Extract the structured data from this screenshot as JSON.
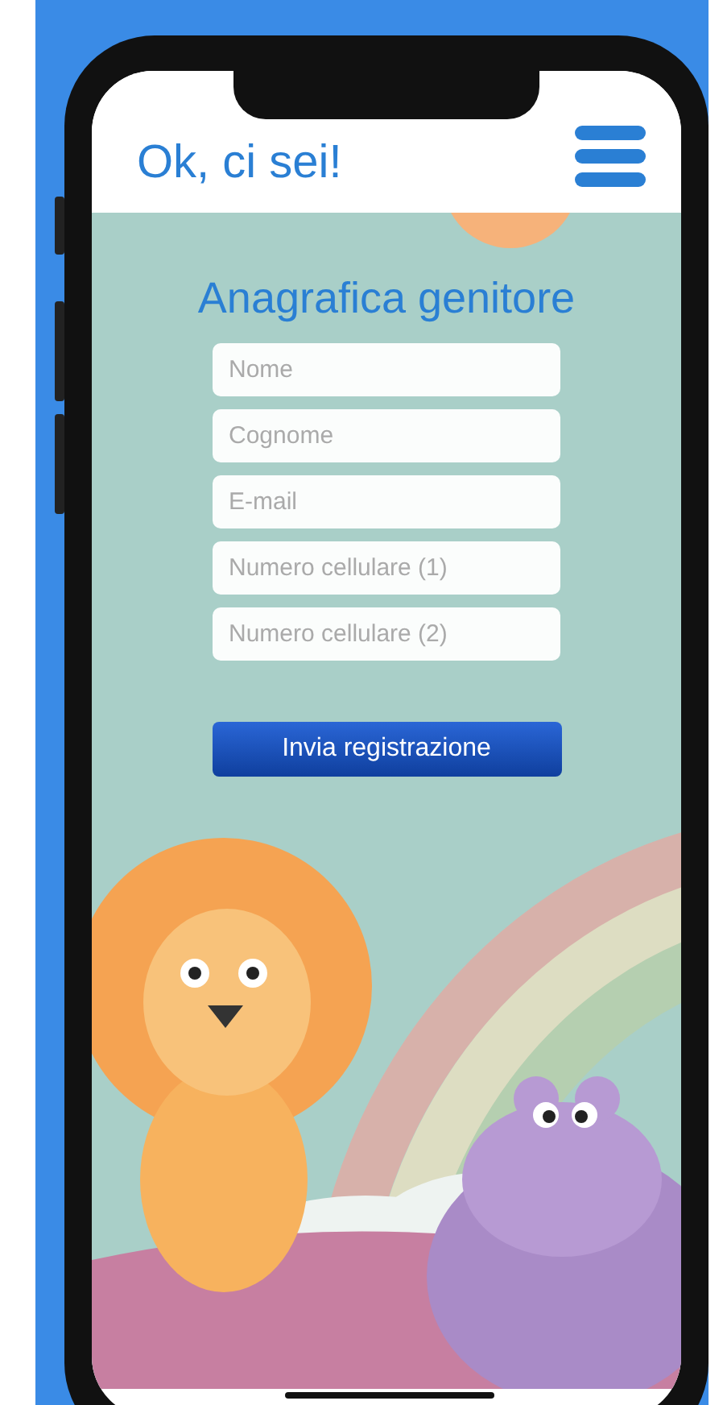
{
  "header": {
    "title": "Ok, ci sei!"
  },
  "form": {
    "title": "Anagrafica genitore",
    "fields": [
      {
        "placeholder": "Nome"
      },
      {
        "placeholder": "Cognome"
      },
      {
        "placeholder": "E-mail"
      },
      {
        "placeholder": "Numero cellulare (1)"
      },
      {
        "placeholder": "Numero cellulare (2)"
      }
    ],
    "submit": "Invia registrazione"
  }
}
